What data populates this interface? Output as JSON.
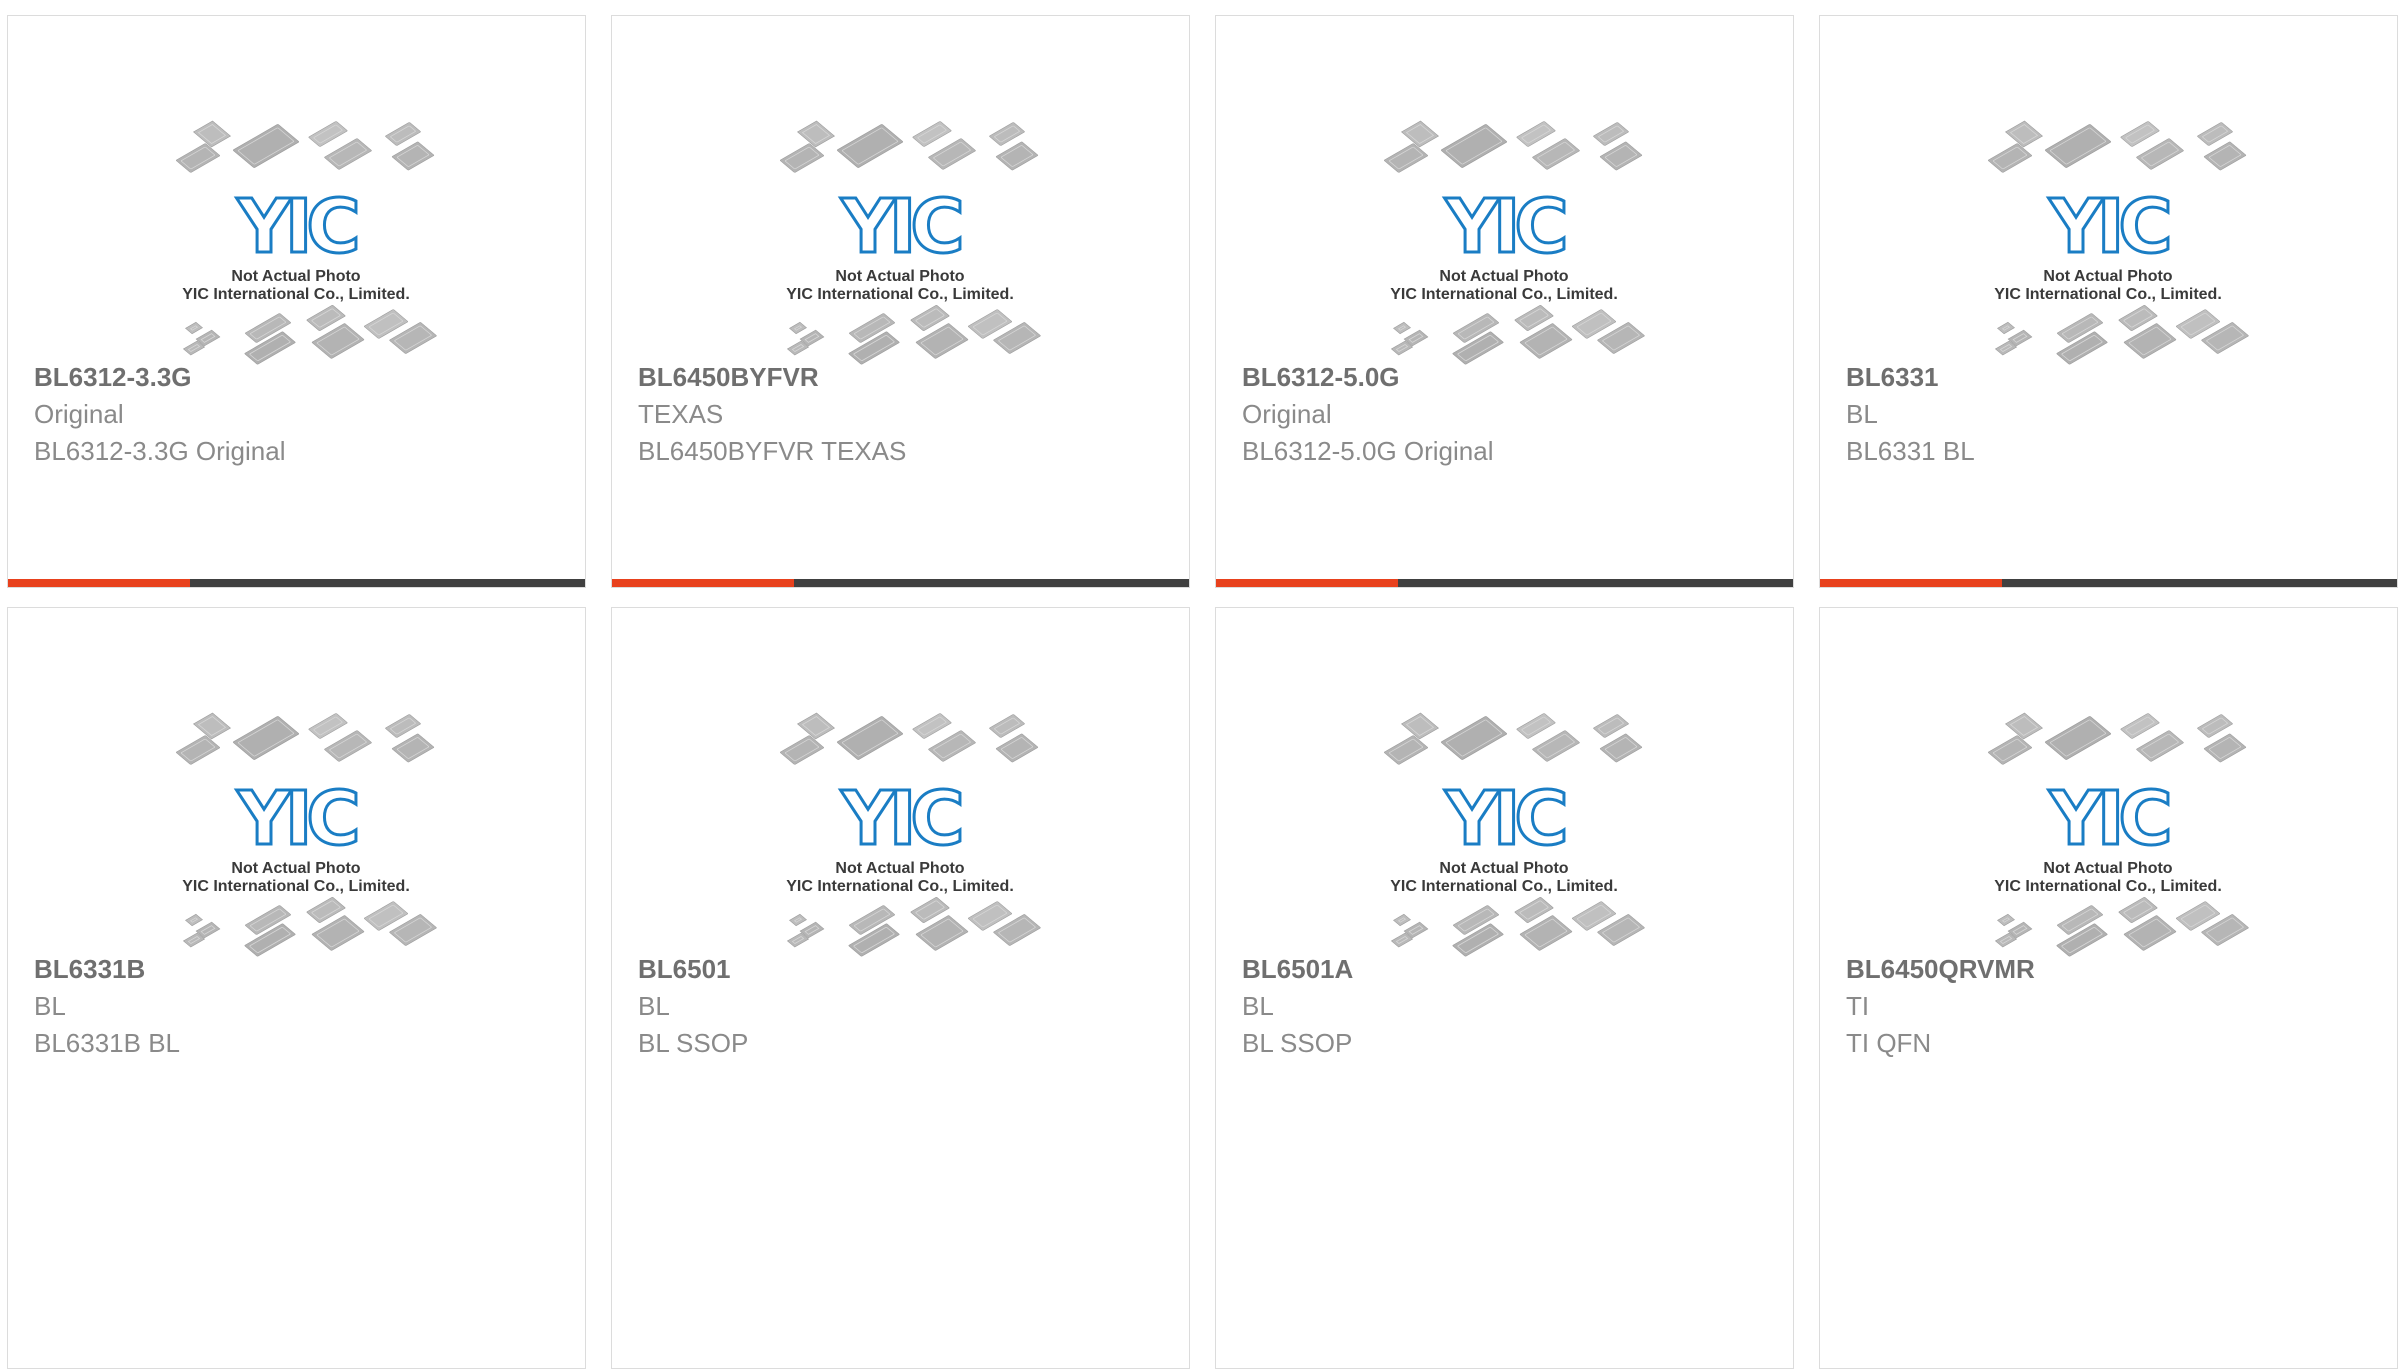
{
  "colors": {
    "accent": "#e8411d",
    "bar_dark": "#404040",
    "logo_blue": "#1a7dc4",
    "title_text": "#6f6f6f",
    "body_text": "#8a8a8a",
    "border": "#dcdcdc"
  },
  "placeholder": {
    "logo_text": "YIC",
    "caption_line1": "Not Actual Photo",
    "caption_line2": "YIC International Co., Limited."
  },
  "products": [
    {
      "part": "BL6312-3.3G",
      "maker": "Original",
      "desc": "BL6312-3.3G Original"
    },
    {
      "part": "BL6450BYFVR",
      "maker": "TEXAS",
      "desc": "BL6450BYFVR TEXAS"
    },
    {
      "part": "BL6312-5.0G",
      "maker": "Original",
      "desc": "BL6312-5.0G Original"
    },
    {
      "part": "BL6331",
      "maker": "BL",
      "desc": "BL6331 BL"
    },
    {
      "part": "BL6331B",
      "maker": "BL",
      "desc": "BL6331B BL"
    },
    {
      "part": "BL6501",
      "maker": "BL",
      "desc": "BL SSOP"
    },
    {
      "part": "BL6501A",
      "maker": "BL",
      "desc": "BL SSOP"
    },
    {
      "part": "BL6450QRVMR",
      "maker": "TI",
      "desc": "TI QFN"
    }
  ]
}
